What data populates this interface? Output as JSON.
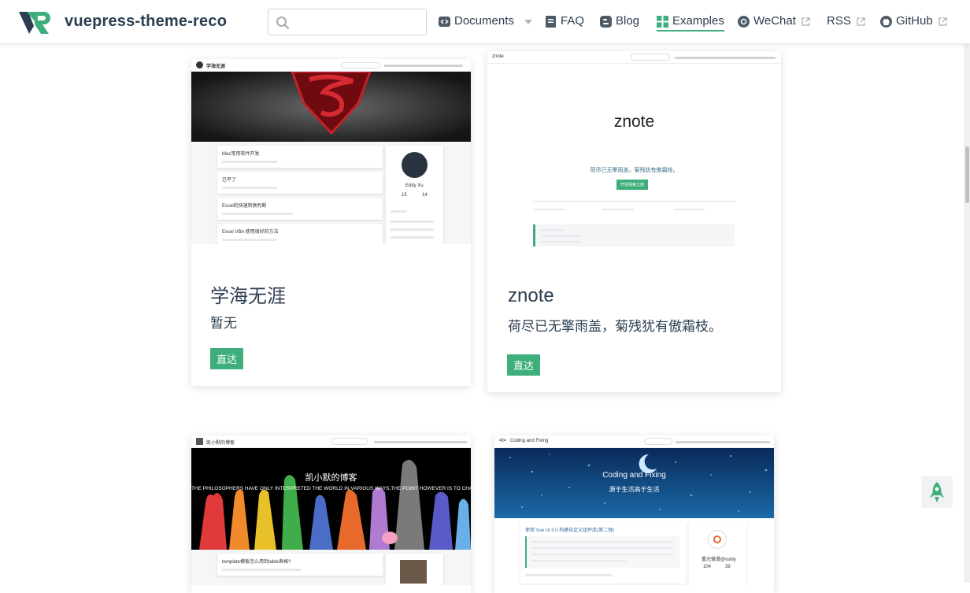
{
  "site": {
    "title": "vuepress-theme-reco"
  },
  "search": {
    "placeholder": "",
    "value": ""
  },
  "nav": [
    {
      "label": "Documents"
    },
    {
      "label": "FAQ"
    },
    {
      "label": "Blog"
    },
    {
      "label": "Examples"
    },
    {
      "label": "WeChat"
    },
    {
      "label": "RSS"
    },
    {
      "label": "GitHub"
    }
  ],
  "colors": {
    "accent": "#3eaf7c",
    "text": "#2c3e50"
  },
  "cards": [
    {
      "title": "学海无涯",
      "desc": "暂无",
      "button": "直达",
      "mini": {
        "site": "学海无涯",
        "posts": [
          "Mac常用软件开发",
          "已平了",
          "Excel的快速转换判断",
          "Excel VBA 使用很好的方法"
        ],
        "author": "Eddy Xu",
        "stats": [
          "15",
          "14"
        ]
      }
    },
    {
      "title": "znote",
      "desc": "荷尽已无擎雨盖，菊残犹有傲霜枝。",
      "button": "直达",
      "mini": {
        "site": "znote",
        "hero": "znote",
        "tagline": "荷尽已无擎雨盖，菊残犹有傲霜枝。",
        "button": "开始探索之旅"
      }
    },
    {
      "title": "凯小默的博客",
      "mini": {
        "site": "凯小默的博客",
        "hero": "凯小默的博客",
        "quote": "THE PHILOSOPHERS HAVE ONLY INTERPRETED THE WORLD IN VARIOUS WAYS,THE POINT HOWEVER IS TO CHANGE IT.",
        "post": "template模板怎么用到table表格?"
      }
    },
    {
      "title": "Coding and Fixing",
      "mini": {
        "site": "Coding and Fixing",
        "hero": "Coding and Fixing",
        "sub": "源于生活高于生活",
        "post": "使用 Vue cli 3.0 构建自定义组件库(第二弹)",
        "author": "重光微漫@vshly",
        "stats": [
          "104",
          "39"
        ]
      }
    }
  ]
}
